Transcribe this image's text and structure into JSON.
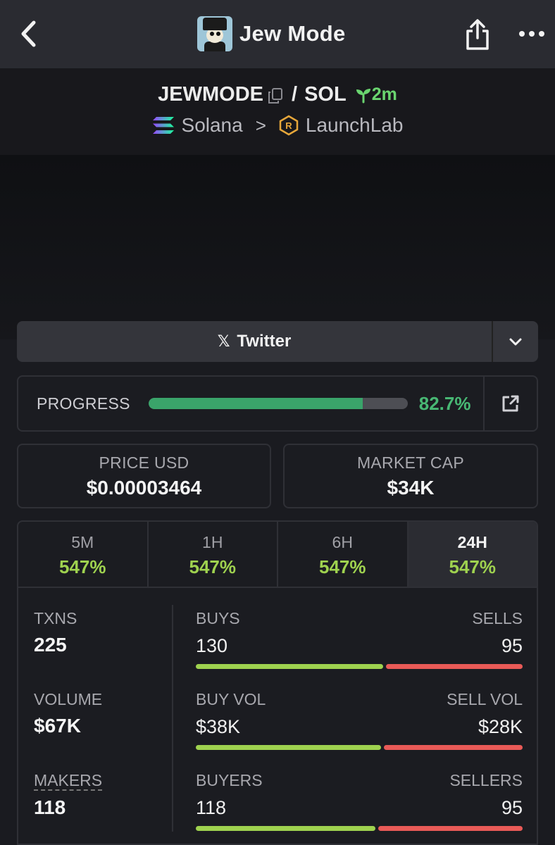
{
  "topbar": {
    "title": "Jew Mode",
    "back_icon": "chevron-left-icon",
    "share_icon": "share-icon",
    "more_icon": "more-icon"
  },
  "pair": {
    "base": "JEWMODE",
    "slash": "/",
    "quote": "SOL",
    "age": "2m"
  },
  "chain": {
    "network": "Solana",
    "separator": ">",
    "launchpad": "LaunchLab"
  },
  "socials": {
    "twitter_label": "Twitter",
    "x_glyph": "𝕏"
  },
  "progress": {
    "label": "PROGRESS",
    "value_text": "82.7%",
    "value_fraction": 0.827
  },
  "stats": {
    "price_label": "PRICE USD",
    "price_value": "$0.00003464",
    "mcap_label": "MARKET CAP",
    "mcap_value": "$34K"
  },
  "timeframes": [
    {
      "name": "5M",
      "pct": "547%"
    },
    {
      "name": "1H",
      "pct": "547%"
    },
    {
      "name": "6H",
      "pct": "547%"
    },
    {
      "name": "24H",
      "pct": "547%",
      "active": true
    }
  ],
  "metrics": {
    "txns": {
      "label": "TXNS",
      "value": "225"
    },
    "volume": {
      "label": "VOLUME",
      "value": "$67K"
    },
    "makers": {
      "label": "MAKERS",
      "value": "118"
    },
    "buys": {
      "left_label": "BUYS",
      "right_label": "SELLS",
      "left_value": "130",
      "right_value": "95",
      "buy_share": 0.578
    },
    "vol": {
      "left_label": "BUY VOL",
      "right_label": "SELL VOL",
      "left_value": "$38K",
      "right_value": "$28K",
      "buy_share": 0.572
    },
    "users": {
      "left_label": "BUYERS",
      "right_label": "SELLERS",
      "left_value": "118",
      "right_value": "95",
      "buy_share": 0.554
    }
  },
  "colors": {
    "accent_green": "#48b874",
    "change_green": "#9fd24f",
    "sell_red": "#e95a57",
    "age_green": "#6ad56f"
  }
}
